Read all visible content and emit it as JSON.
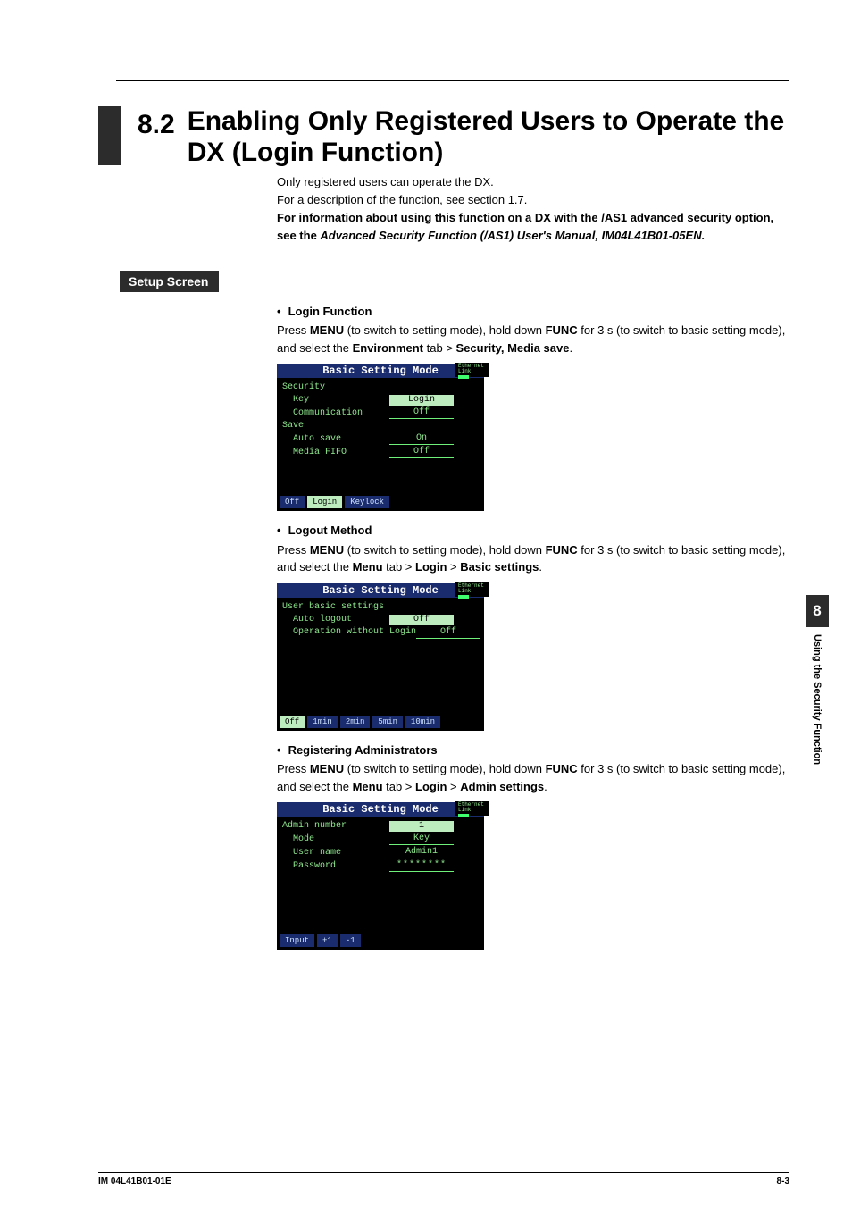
{
  "section_number": "8.2",
  "title_line1": "Enabling Only Registered Users to Operate the",
  "title_line2": "DX (Login Function)",
  "intro": {
    "p1": "Only registered users can operate the DX.",
    "p2": "For a description of the function, see section 1.7.",
    "p3a": "For information about using this function on a DX with the /AS1 advanced security option, see the ",
    "p3b": "Advanced Security Function (/AS1) User's Manual, IM04L41B01-05EN.",
    "p3c": ""
  },
  "setup_label": "Setup Screen",
  "login": {
    "heading": "Login Function",
    "before_menu": "Press ",
    "menu": "MENU",
    "mid1": " (to switch to setting mode), hold down ",
    "func": "FUNC",
    "mid2": " for 3 s (to switch to basic setting mode), and select the ",
    "env": "Environment",
    "mid3": " tab > ",
    "sec": "Security, Media save",
    "end": ".",
    "screen": {
      "title": "Basic Setting Mode",
      "eth": "Ethernet Link",
      "rows": [
        [
          "Security",
          ""
        ],
        [
          "  Key",
          "Login",
          "sel"
        ],
        [
          "  Communication",
          "Off",
          "vbox"
        ],
        [
          "Save",
          ""
        ],
        [
          "  Auto save",
          "On",
          "vbox"
        ],
        [
          "  Media FIFO",
          "Off",
          "vbox"
        ]
      ],
      "softkeys": [
        "Off",
        "Login",
        "Keylock"
      ],
      "softkeys_sel": 1
    }
  },
  "logout": {
    "heading": "Logout Method",
    "before_menu": "Press ",
    "menu": "MENU",
    "mid1": " (to switch to setting mode), hold down ",
    "func": "FUNC",
    "mid2": " for 3 s (to switch to basic setting mode), and select the ",
    "tab": "Menu",
    "mid3": " tab > ",
    "p1": "Login",
    "mid4": " > ",
    "p2": "Basic settings",
    "end": ".",
    "screen": {
      "title": "Basic Setting Mode",
      "eth": "Ethernet Link",
      "head": "User basic settings",
      "rows": [
        [
          "  Auto logout",
          "Off",
          "sel"
        ],
        [
          "  Operation without Login",
          "Off",
          "vbox"
        ]
      ],
      "softkeys": [
        "Off",
        "1min",
        "2min",
        "5min",
        "10min"
      ],
      "softkeys_sel": 0
    }
  },
  "admin": {
    "heading": "Registering Administrators",
    "before_menu": "Press ",
    "menu": "MENU",
    "mid1": " (to switch to setting mode), hold down ",
    "func": "FUNC",
    "mid2": " for 3 s (to switch to basic setting mode), and select the ",
    "tab": "Menu",
    "mid3": " tab > ",
    "p1": "Login",
    "mid4": " > ",
    "p2": "Admin settings",
    "end": ".",
    "screen": {
      "title": "Basic Setting Mode",
      "eth": "Ethernet Link",
      "rows": [
        [
          "Admin number",
          "1",
          "sel"
        ],
        [
          "  Mode",
          "Key",
          "vbox"
        ],
        [
          "  User name",
          "Admin1",
          "vbox"
        ],
        [
          "  Password",
          "********",
          "vbox"
        ]
      ],
      "softkeys": [
        "Input",
        "+1",
        "-1"
      ]
    }
  },
  "side": {
    "num": "8",
    "label": "Using the Security Function"
  },
  "footer": {
    "left": "IM 04L41B01-01E",
    "right": "8-3"
  }
}
